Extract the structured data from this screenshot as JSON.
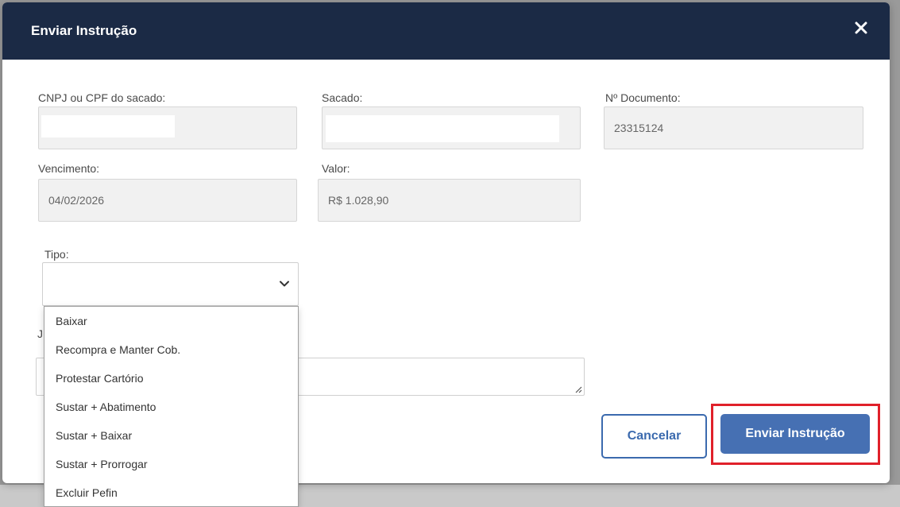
{
  "dialog": {
    "title": "Enviar Instrução",
    "close_symbol": "✕"
  },
  "fields": {
    "cnpj_label": "CNPJ ou CPF do sacado:",
    "cnpj_value": "",
    "sacado_label": "Sacado:",
    "sacado_value": "",
    "documento_label": "Nº Documento:",
    "documento_value": "23315124",
    "vencimento_label": "Vencimento:",
    "vencimento_value": "04/02/2026",
    "valor_label": "Valor:",
    "valor_value": "R$ 1.028,90",
    "tipo_label": "Tipo:",
    "tipo_value": "",
    "justificativa_label_partial": "J"
  },
  "tipo_options": [
    "Baixar",
    "Recompra e Manter Cob.",
    "Protestar Cartório",
    "Sustar + Abatimento",
    "Sustar + Baixar",
    "Sustar + Prorrogar",
    "Excluir Pefin"
  ],
  "buttons": {
    "cancel_label": "Cancelar",
    "send_label": "Enviar Instrução"
  },
  "colors": {
    "header_bg": "#1b2a45",
    "primary": "#4670b3",
    "highlight": "#e0202a"
  },
  "icons": {
    "close": "close-icon",
    "chevron": "chevron-down-icon",
    "resize": "resize-grip-icon"
  }
}
